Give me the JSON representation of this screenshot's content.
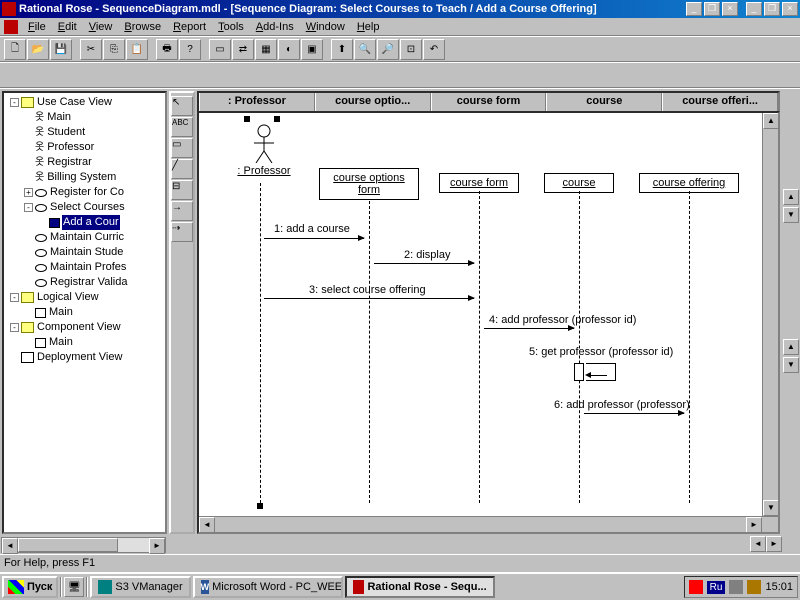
{
  "titlebar": {
    "text": "Rational Rose - SequenceDiagram.mdl - [Sequence Diagram: Select Courses to Teach / Add a Course Offering]"
  },
  "menu": {
    "items": [
      "File",
      "Edit",
      "View",
      "Browse",
      "Report",
      "Tools",
      "Add-Ins",
      "Window",
      "Help"
    ]
  },
  "tree": {
    "root": "Use Case View",
    "items": [
      {
        "indent": 0,
        "pm": "-",
        "icon": "folder",
        "label": "Use Case View"
      },
      {
        "indent": 1,
        "pm": "",
        "icon": "actor",
        "label": "Main"
      },
      {
        "indent": 1,
        "pm": "",
        "icon": "actor",
        "label": "Student"
      },
      {
        "indent": 1,
        "pm": "",
        "icon": "actor",
        "label": "Professor"
      },
      {
        "indent": 1,
        "pm": "",
        "icon": "actor",
        "label": "Registrar"
      },
      {
        "indent": 1,
        "pm": "",
        "icon": "actor",
        "label": "Billing System"
      },
      {
        "indent": 1,
        "pm": "+",
        "icon": "usecase",
        "label": "Register for Co"
      },
      {
        "indent": 1,
        "pm": "-",
        "icon": "usecase",
        "label": "Select Courses"
      },
      {
        "indent": 2,
        "pm": "",
        "icon": "diag",
        "label": "Add a Cour",
        "selected": true
      },
      {
        "indent": 1,
        "pm": "",
        "icon": "usecase",
        "label": "Maintain Curric"
      },
      {
        "indent": 1,
        "pm": "",
        "icon": "usecase",
        "label": "Maintain Stude"
      },
      {
        "indent": 1,
        "pm": "",
        "icon": "usecase",
        "label": "Maintain Profes"
      },
      {
        "indent": 1,
        "pm": "",
        "icon": "usecase",
        "label": "Registrar Valida"
      },
      {
        "indent": 0,
        "pm": "-",
        "icon": "folder",
        "label": "Logical View"
      },
      {
        "indent": 1,
        "pm": "",
        "icon": "diag",
        "label": "Main"
      },
      {
        "indent": 0,
        "pm": "-",
        "icon": "folder",
        "label": "Component View"
      },
      {
        "indent": 1,
        "pm": "",
        "icon": "diag",
        "label": "Main"
      },
      {
        "indent": 0,
        "pm": "",
        "icon": "box",
        "label": "Deployment View"
      }
    ]
  },
  "columns": [
    ": Professor",
    "course optio...",
    "course form",
    "course",
    "course offeri..."
  ],
  "diagram": {
    "actor": {
      "label": ": Professor"
    },
    "objects": [
      {
        "label": "course options form"
      },
      {
        "label": "course form"
      },
      {
        "label": "course"
      },
      {
        "label": "course offering"
      }
    ],
    "messages": [
      {
        "n": "1",
        "text": "add a course"
      },
      {
        "n": "2",
        "text": "display"
      },
      {
        "n": "3",
        "text": "select course offering"
      },
      {
        "n": "4",
        "text": "add professor (professor id)"
      },
      {
        "n": "5",
        "text": "get professor (professor id)"
      },
      {
        "n": "6",
        "text": "add professor (professor)"
      }
    ]
  },
  "status": "For Help, press F1",
  "taskbar": {
    "start": "Пуск",
    "tasks": [
      {
        "label": "S3 VManager",
        "active": false
      },
      {
        "label": "Microsoft Word - PC_WEE...",
        "active": false
      },
      {
        "label": "Rational Rose - Sequ...",
        "active": true
      }
    ],
    "lang": "Ru",
    "clock": "15:01"
  }
}
